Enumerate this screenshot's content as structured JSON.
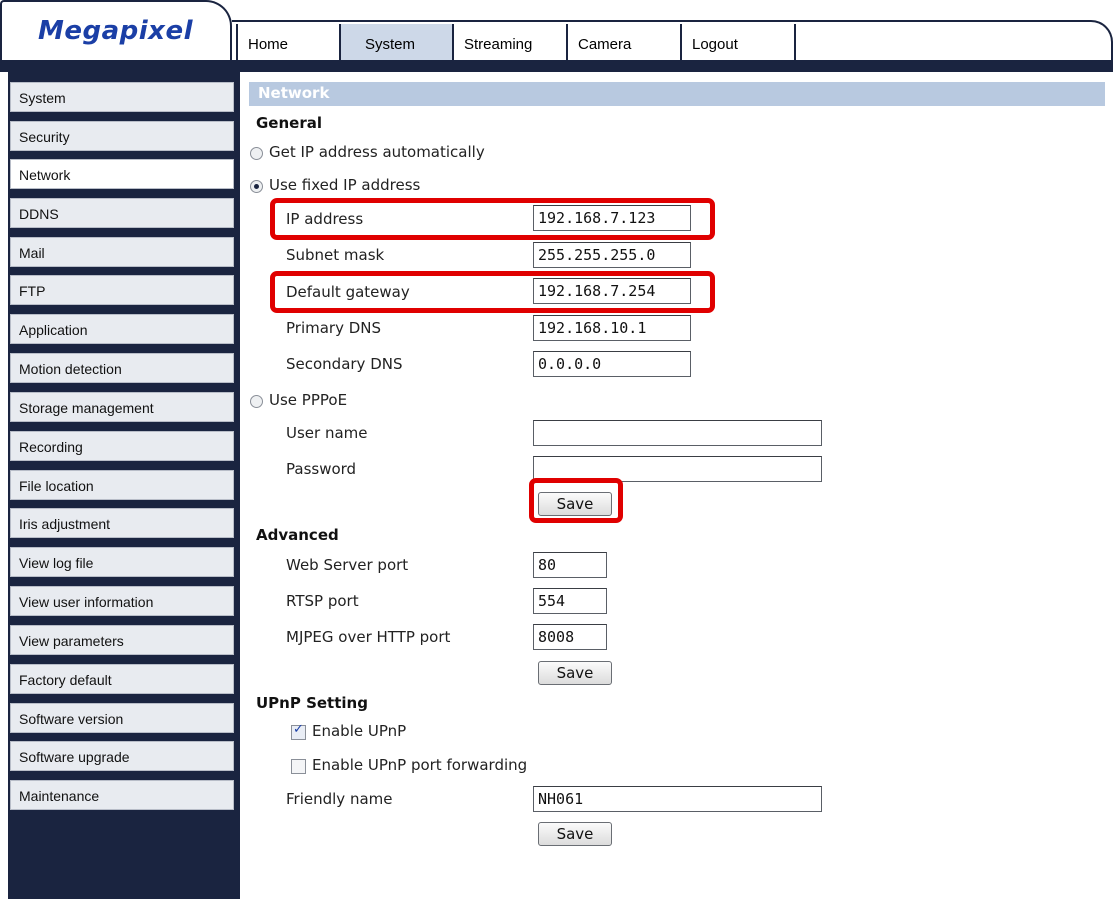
{
  "brand": {
    "logo": "Megapixel"
  },
  "nav": {
    "tabs": [
      {
        "label": "Home",
        "active": false
      },
      {
        "label": "System",
        "active": true
      },
      {
        "label": "Streaming",
        "active": false
      },
      {
        "label": "Camera",
        "active": false
      },
      {
        "label": "Logout",
        "active": false
      }
    ]
  },
  "sidebar": {
    "items": [
      {
        "label": "System"
      },
      {
        "label": "Security"
      },
      {
        "label": "Network",
        "active": true
      },
      {
        "label": "DDNS"
      },
      {
        "label": "Mail"
      },
      {
        "label": "FTP"
      },
      {
        "label": "Application"
      },
      {
        "label": "Motion detection"
      },
      {
        "label": "Storage management"
      },
      {
        "label": "Recording"
      },
      {
        "label": "File location"
      },
      {
        "label": "Iris adjustment"
      },
      {
        "label": "View log file"
      },
      {
        "label": "View user information"
      },
      {
        "label": "View parameters"
      },
      {
        "label": "Factory default"
      },
      {
        "label": "Software version"
      },
      {
        "label": "Software upgrade"
      },
      {
        "label": "Maintenance"
      }
    ]
  },
  "page": {
    "title": "Network"
  },
  "general": {
    "heading": "General",
    "auto_ip_label": "Get IP address automatically",
    "fixed_ip_label": "Use fixed IP address",
    "selected": "fixed",
    "ip_label": "IP address",
    "ip_value": "192.168.7.123",
    "subnet_label": "Subnet mask",
    "subnet_value": "255.255.255.0",
    "gateway_label": "Default gateway",
    "gateway_value": "192.168.7.254",
    "primary_dns_label": "Primary DNS",
    "primary_dns_value": "192.168.10.1",
    "secondary_dns_label": "Secondary DNS",
    "secondary_dns_value": "0.0.0.0",
    "pppoe_label": "Use PPPoE",
    "username_label": "User name",
    "username_value": "",
    "password_label": "Password",
    "password_value": "",
    "save_label": "Save"
  },
  "advanced": {
    "heading": "Advanced",
    "web_port_label": "Web Server port",
    "web_port_value": "80",
    "rtsp_label": "RTSP port",
    "rtsp_value": "554",
    "mjpeg_label": "MJPEG over HTTP port",
    "mjpeg_value": "8008",
    "save_label": "Save"
  },
  "upnp": {
    "heading": "UPnP Setting",
    "enable_label": "Enable UPnP",
    "enable_checked": true,
    "forwarding_label": "Enable UPnP port forwarding",
    "forwarding_checked": false,
    "friendly_label": "Friendly name",
    "friendly_value": "NH061",
    "save_label": "Save"
  },
  "colors": {
    "navy": "#1a2440",
    "highlight": "#e00000",
    "logo": "#1b3fa6",
    "section_bar": "#b8c9e0"
  }
}
